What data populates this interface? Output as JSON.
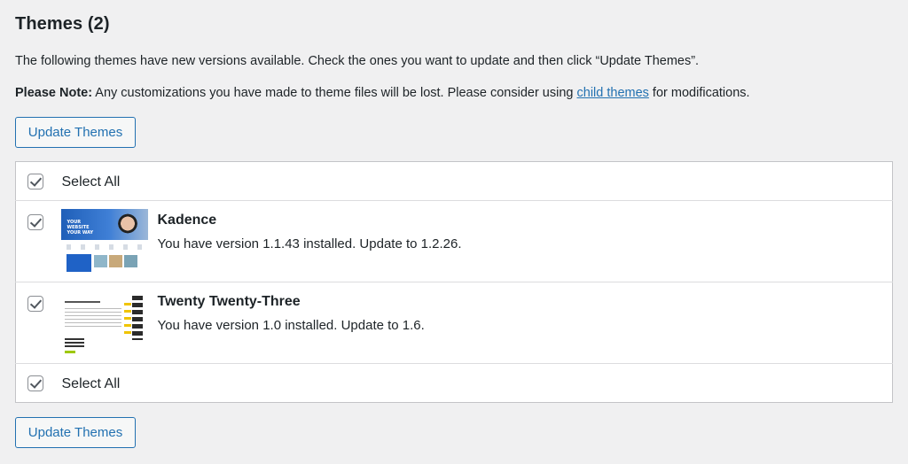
{
  "page": {
    "title": "Themes (2)",
    "intro": "The following themes have new versions available. Check the ones you want to update and then click “Update Themes”.",
    "note_label": "Please Note:",
    "note_text": " Any customizations you have made to theme files will be lost. Please consider using ",
    "note_link": "child themes",
    "note_end": " for modifications."
  },
  "buttons": {
    "update_top": "Update Themes",
    "update_bottom": "Update Themes"
  },
  "table": {
    "select_all_top": "Select All",
    "select_all_bottom": "Select All",
    "themes": [
      {
        "name": "Kadence",
        "description": "You have version 1.1.43 installed. Update to 1.2.26.",
        "checked": true,
        "thumbnail_text": "YOUR WEBSITE YOUR WAY"
      },
      {
        "name": "Twenty Twenty-Three",
        "description": "You have version 1.0 installed. Update to 1.6.",
        "checked": true
      }
    ]
  },
  "colors": {
    "accent": "#2271b1",
    "background": "#f0f0f1",
    "text": "#1d2327"
  }
}
